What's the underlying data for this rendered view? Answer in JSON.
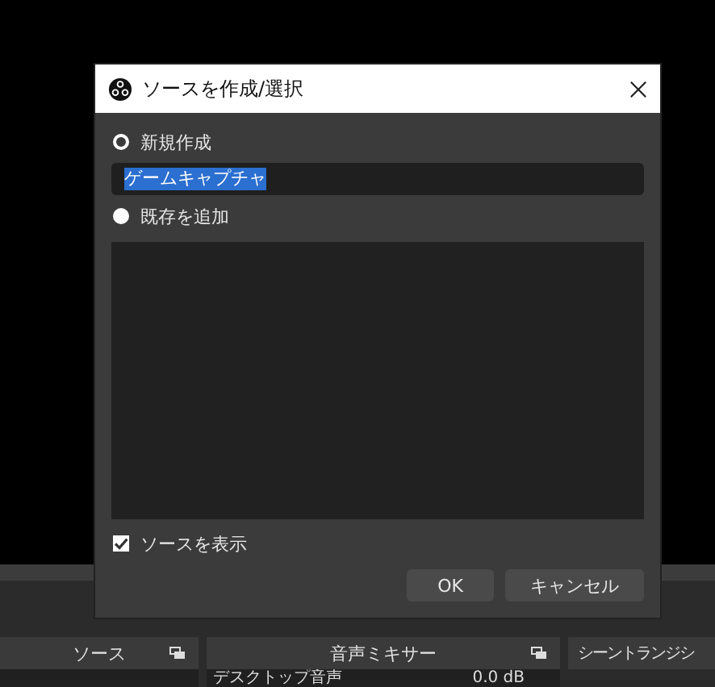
{
  "dialog": {
    "title": "ソースを作成/選択",
    "options": [
      {
        "label": "新規作成",
        "selected": true
      },
      {
        "label": "既存を追加",
        "selected": false
      }
    ],
    "name_field": {
      "value": "ゲームキャプチャ"
    },
    "show_source": {
      "label": "ソースを表示",
      "checked": true
    },
    "buttons": [
      "OK",
      "キャンセル"
    ]
  },
  "docks": [
    {
      "title": "ソース"
    },
    {
      "title": "音声ミキサー"
    },
    {
      "title": "シーントランジシ"
    }
  ],
  "mixer": {
    "channel": "デスクトップ音声",
    "reading": "0.0 dB"
  }
}
